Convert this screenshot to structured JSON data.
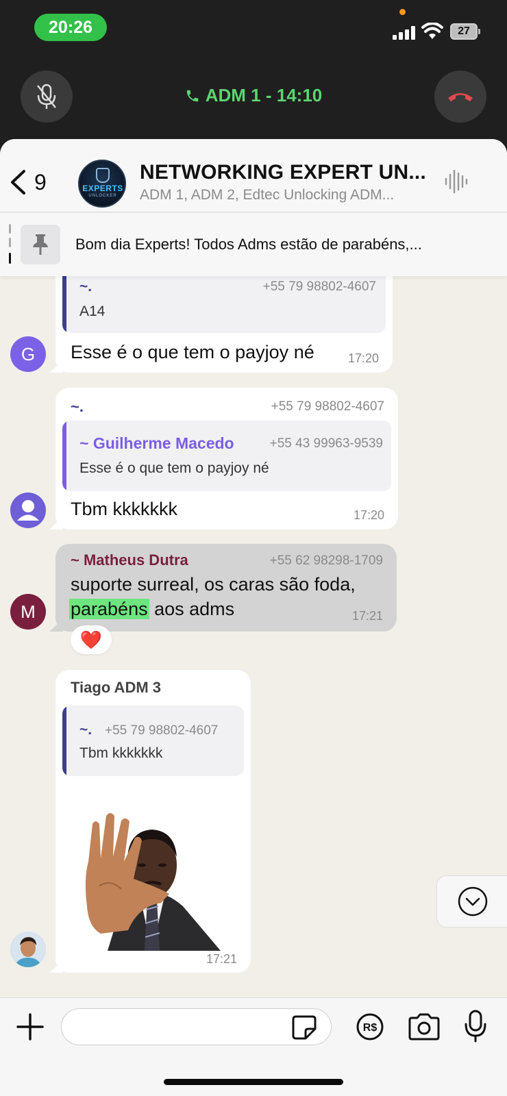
{
  "status_bar": {
    "time": "20:26",
    "battery": "27"
  },
  "call": {
    "label": "ADM 1 - 14:10"
  },
  "header": {
    "back_count": "9",
    "title": "NETWORKING EXPERT UN...",
    "members": "ADM 1, ADM 2, Edtec Unlocking ADM...",
    "avatar_logo_text": "EXPERTS",
    "avatar_logo_sub": "UNLOCKER"
  },
  "pinned": {
    "text": "Bom dia Experts! Todos Adms estão de parabéns,..."
  },
  "messages": [
    {
      "quote_name": "~.",
      "quote_phone": "+55 79 98802-4607",
      "quote_text": "A14",
      "avatar_letter": "G",
      "text": "Esse é o que tem o payjoy né",
      "time": "17:20"
    },
    {
      "sender_name": "~.",
      "sender_phone": "+55 79 98802-4607",
      "quote_name": "~ Guilherme Macedo",
      "quote_phone": "+55 43 99963-9539",
      "quote_text": "Esse é o que tem o payjoy né",
      "text": "Tbm kkkkkkk",
      "time": "17:20"
    },
    {
      "sender_name": "~ Matheus Dutra",
      "sender_phone": "+55 62 98298-1709",
      "line1": "suporte surreal, os caras são foda,",
      "highlight": "parabéns",
      "line2_rest": "aos adms",
      "time": "17:21",
      "avatar_letter": "M",
      "reaction": "❤️"
    },
    {
      "sender_name": "Tiago ADM 3",
      "quote_name": "~.",
      "quote_phone": "+55 79 98802-4607",
      "quote_text": "Tbm kkkkkkk",
      "time": "17:21"
    }
  ],
  "composer": {
    "placeholder": "",
    "pay_label": "R$"
  },
  "colors": {
    "call_green": "#32c149",
    "end_red": "#e5484d",
    "guilherme_violet": "#7a5ee2",
    "matheus_maroon": "#7a1f3d",
    "highlight": "#6ee57f"
  }
}
